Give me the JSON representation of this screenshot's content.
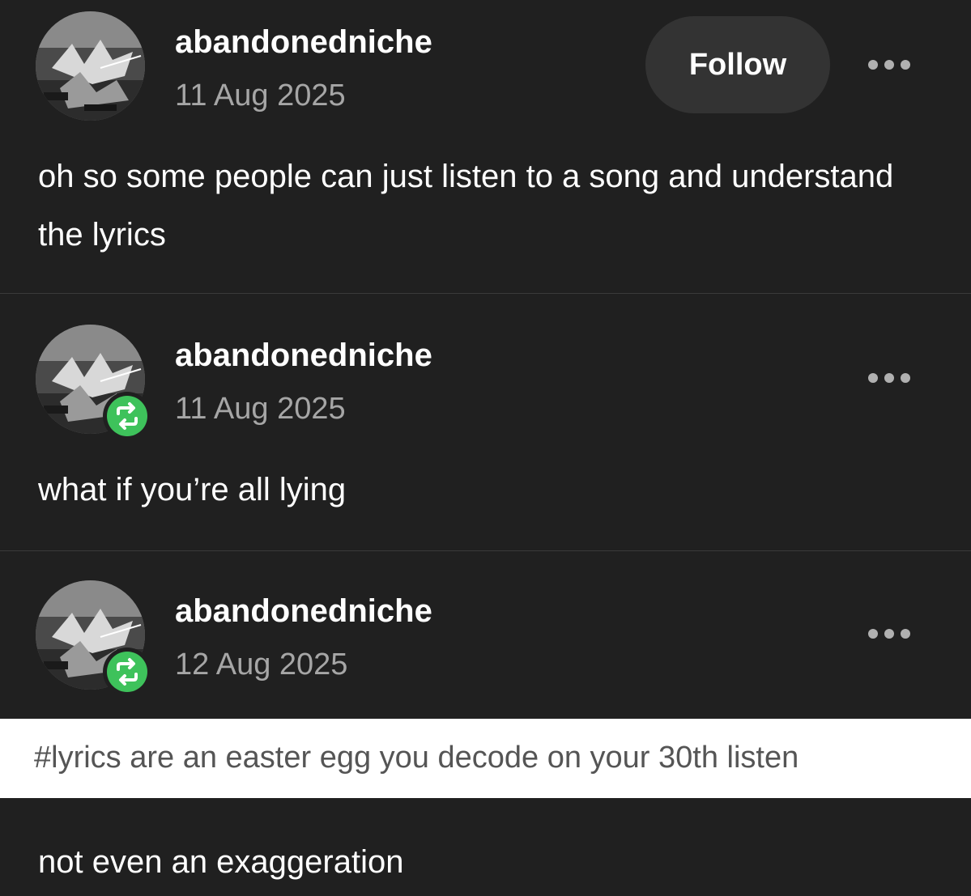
{
  "posts": [
    {
      "username": "abandonedniche",
      "date": "11 Aug 2025",
      "follow_label": "Follow",
      "body": "oh so some people can just listen to a song and understand the lyrics",
      "is_reblog": false
    },
    {
      "username": "abandonedniche",
      "date": "11 Aug 2025",
      "body": "what if you’re all lying",
      "is_reblog": true
    },
    {
      "username": "abandonedniche",
      "date": "12 Aug 2025",
      "tag": "#lyrics are an easter egg you decode on your 30th listen",
      "body": "not even an exaggeration",
      "is_reblog": true
    }
  ],
  "icons": {
    "more": "more-options-icon",
    "reblog": "reblog-icon"
  },
  "colors": {
    "background": "#202020",
    "follow_button": "#333333",
    "reblog_badge": "#3ec25b",
    "date_text": "#a6a6a6",
    "tag_bar": "#ffffff",
    "tag_text": "#555555"
  }
}
